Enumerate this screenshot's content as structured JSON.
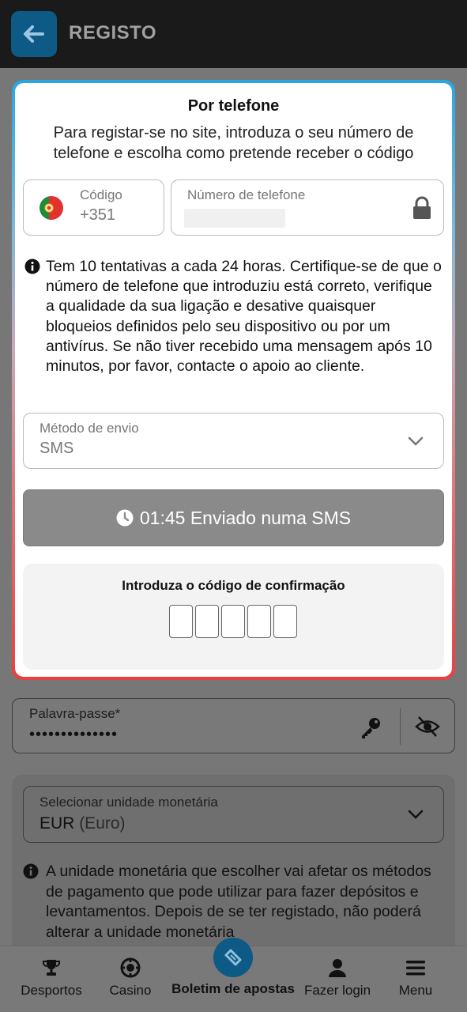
{
  "header": {
    "title": "REGISTO",
    "back_icon": "arrow-left-icon"
  },
  "modal": {
    "title": "Por telefone",
    "subtitle": "Para registar-se no site, introduza o seu número de telefone e escolha como pretende receber o código",
    "country_code": {
      "label": "Código",
      "value": "+351",
      "flag": "portugal-flag-icon"
    },
    "phone": {
      "label": "Número de telefone",
      "value": ""
    },
    "info_text": "Tem 10 tentativas a cada 24 horas. Certifique-se de que o número de telefone que introduziu está correto, verifique a qualidade da sua ligação e desative quaisquer bloqueios definidos pelo seu dispositivo ou por um antivírus. Se não tiver recebido uma mensagem após 10 minutos, por favor, contacte o apoio ao cliente.",
    "send_method": {
      "label": "Método de envio",
      "value": "SMS"
    },
    "timer_button": {
      "label": "01:45 Enviado numa SMS"
    },
    "confirmation": {
      "label": "Introduza o código de confirmação",
      "digit_count": 5
    }
  },
  "password": {
    "label": "Palavra-passe*",
    "value": "••••••••••••••"
  },
  "currency": {
    "label": "Selecionar unidade monetária",
    "value_code": "EUR",
    "value_name": "(Euro)",
    "note": "A unidade monetária que escolher vai afetar os métodos de pagamento que pode utilizar para fazer depósitos e levantamentos. Depois de se ter registado, não poderá alterar a unidade monetária"
  },
  "bottom_nav": {
    "sports": "Desportos",
    "casino": "Casino",
    "betslip": "Boletim de apostas",
    "login": "Fazer login",
    "menu": "Menu"
  },
  "colors": {
    "accent": "#0d5a86",
    "gradient_top": "#2aa6e0",
    "gradient_bottom": "#e84040"
  }
}
